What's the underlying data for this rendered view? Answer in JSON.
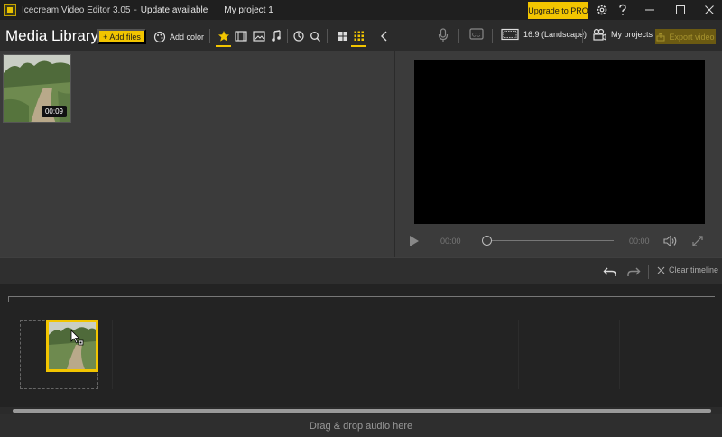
{
  "titlebar": {
    "app_name": "Icecream Video Editor 3.05",
    "separator": "-",
    "update_link": "Update available",
    "project_name": "My project 1",
    "upgrade_label": "Upgrade to PRO"
  },
  "media_library": {
    "title": "Media Library",
    "add_files_label": "+ Add files",
    "add_color_label": "Add color",
    "items": [
      {
        "type": "video",
        "duration": "00:09"
      }
    ]
  },
  "right_toolbar": {
    "aspect_label": "16:9 (Landscape)",
    "my_projects_label": "My projects",
    "export_label": "Export video"
  },
  "player": {
    "current_time": "00:00",
    "total_time": "00:00"
  },
  "timeline": {
    "clear_label": "Clear timeline"
  },
  "audio_zone": {
    "label": "Drag & drop audio here"
  },
  "colors": {
    "accent": "#f2c500",
    "background": "#2b2b2b",
    "panel": "#3b3b3b"
  }
}
